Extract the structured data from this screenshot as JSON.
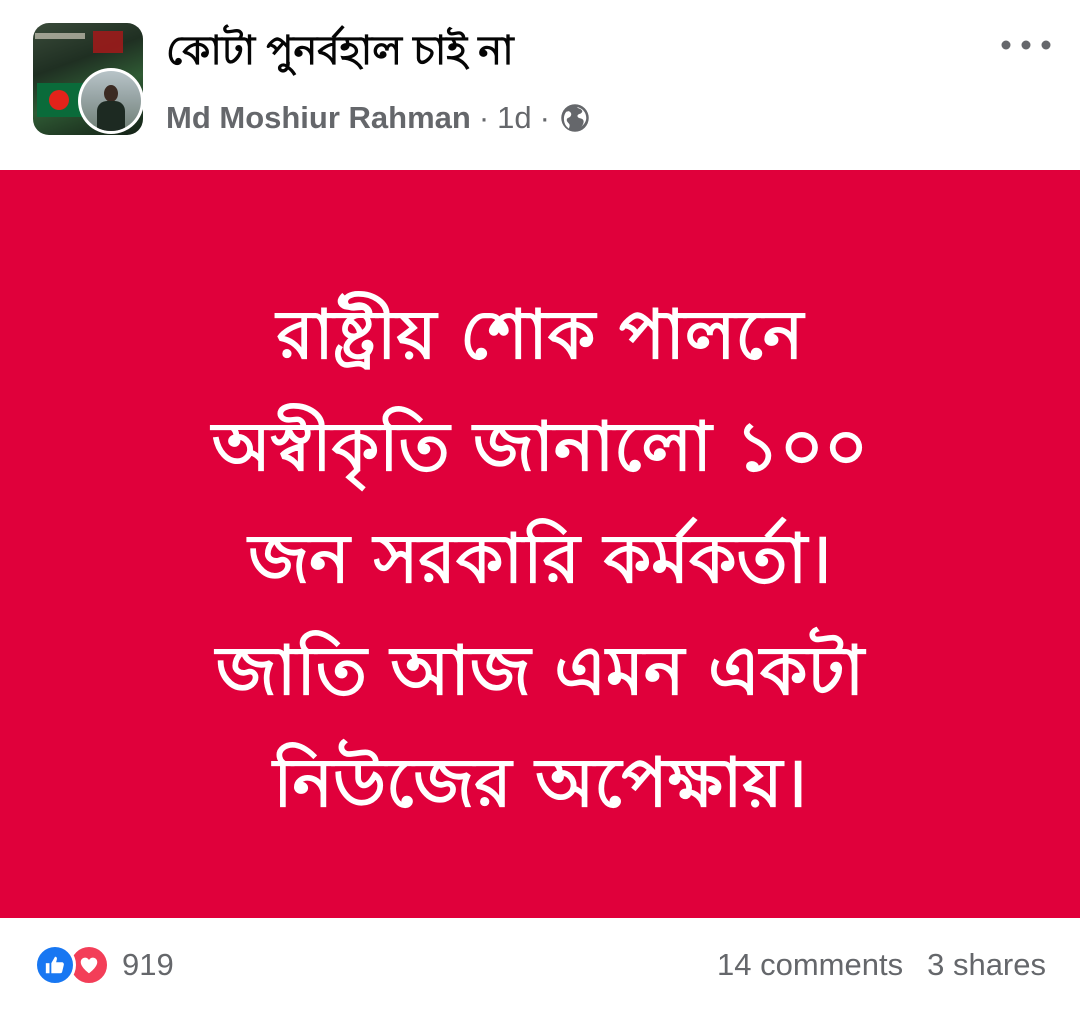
{
  "post": {
    "group_name": "কোটা পুনর্বহাল চাই না",
    "author": "Md Moshiur Rahman",
    "time": "1d",
    "separator": "·",
    "privacy_icon": "globe-icon",
    "more_icon": "more-options-icon",
    "text_lines": [
      "রাষ্ট্রীয় শোক পালনে",
      "অস্বীকৃতি জানালো ১০০",
      "জন সরকারি কর্মকর্তা।",
      "জাতি আজ এমন একটা",
      "নিউজের অপেক্ষায়।"
    ],
    "background_color": "#e0003b"
  },
  "footer": {
    "reaction_icons": [
      "like-icon",
      "love-icon"
    ],
    "reaction_count": "919",
    "comments": "14 comments",
    "shares": "3 shares"
  },
  "colors": {
    "like_blue": "#1877f2",
    "love_red": "#f33e58",
    "secondary_text": "#65676b"
  }
}
